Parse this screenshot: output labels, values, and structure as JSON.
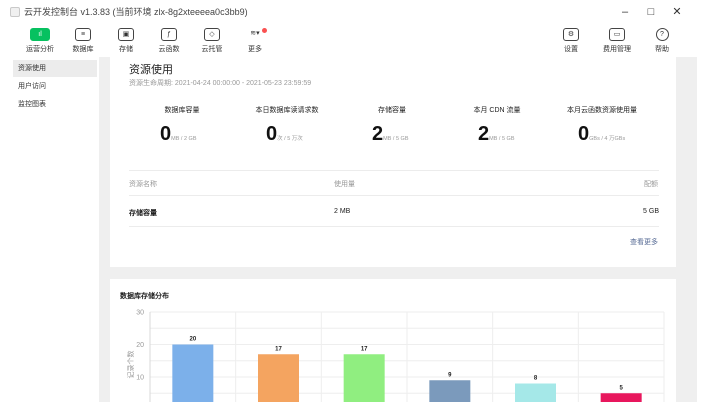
{
  "window": {
    "title": "云开发控制台 v1.3.83 (当前环境 zlx-8g2xteeeea0c3bb9)",
    "min_glyph": "–",
    "max_glyph": "□",
    "close_glyph": "✕"
  },
  "toolbar": {
    "left": [
      {
        "label": "运营分析",
        "icon": "chart-icon",
        "glyph": "ıl",
        "active": true
      },
      {
        "label": "数据库",
        "icon": "database-icon",
        "glyph": "≡"
      },
      {
        "label": "存储",
        "icon": "storage-icon",
        "glyph": "▣"
      },
      {
        "label": "云函数",
        "icon": "function-icon",
        "glyph": "ƒ"
      },
      {
        "label": "云托管",
        "icon": "container-icon",
        "glyph": "◇"
      },
      {
        "label": "更多",
        "icon": "more-icon",
        "glyph": "≋▾"
      }
    ],
    "right": [
      {
        "label": "设置",
        "icon": "gear-icon",
        "glyph": "⚙"
      },
      {
        "label": "费用管理",
        "icon": "billing-icon",
        "glyph": "▭"
      },
      {
        "label": "帮助",
        "icon": "help-icon",
        "glyph": "?"
      }
    ]
  },
  "sidebar": {
    "items": [
      {
        "label": "资源使用",
        "active": true
      },
      {
        "label": "用户访问"
      },
      {
        "label": "监控图表"
      }
    ]
  },
  "resource": {
    "title": "资源使用",
    "cycle_label": "资源生命周期:",
    "cycle_range": "2021-04-24 00:00:00 - 2021-05-23 23:59:59",
    "stats": [
      {
        "label": "数据库容量",
        "value": "0",
        "unit": "MB / 2 GB"
      },
      {
        "label": "本日数据库读请求数",
        "value": "0",
        "unit": "次 / 5 万次"
      },
      {
        "label": "存储容量",
        "value": "2",
        "unit": "MB / 5 GB"
      },
      {
        "label": "本月 CDN 流量",
        "value": "2",
        "unit": "MB / 5 GB"
      },
      {
        "label": "本月云函数资源使用量",
        "value": "0",
        "unit": "GBs / 4 万GBs"
      }
    ],
    "table": {
      "headers": [
        "资源名称",
        "使用量",
        "配额"
      ],
      "rows": [
        {
          "name": "存储容量",
          "usage": "2 MB",
          "quota": "5 GB"
        }
      ]
    },
    "view_more": "查看更多"
  },
  "chart_data": {
    "type": "bar",
    "title": "数据库存储分布",
    "ylabel": "记录个数",
    "ylim": [
      0,
      30
    ],
    "yticks": [
      "30",
      "20",
      "10"
    ],
    "categories": [
      "",
      "",
      "",
      "",
      "",
      ""
    ],
    "values": [
      20,
      17,
      17,
      9,
      8,
      5
    ],
    "colors": [
      "#7cb0ea",
      "#f4a460",
      "#90ee80",
      "#7b9abc",
      "#a5e8e8",
      "#e8175d"
    ],
    "grid": true
  }
}
